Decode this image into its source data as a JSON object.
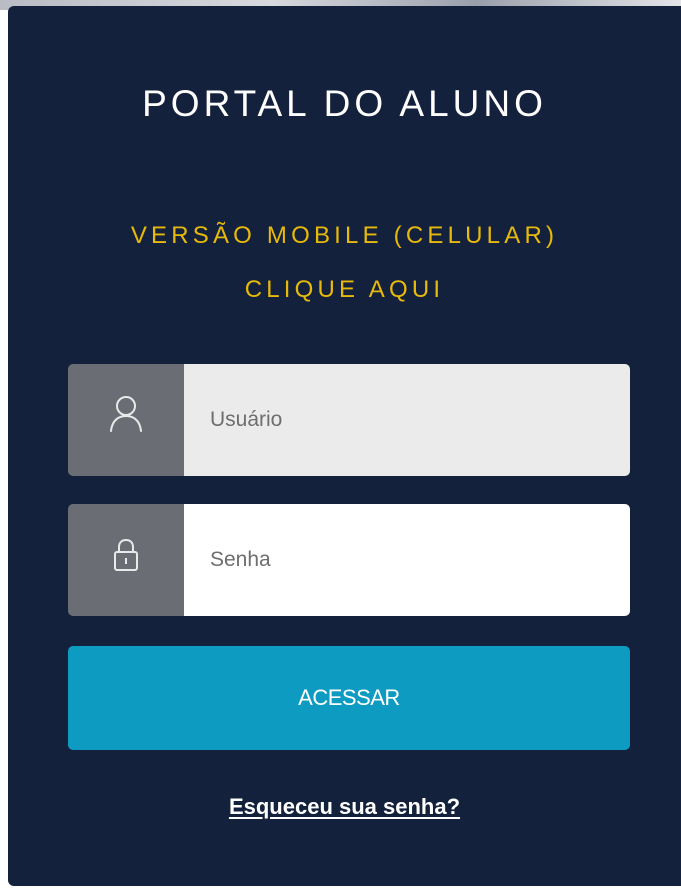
{
  "portal": {
    "title": "PORTAL DO ALUNO",
    "mobile_link_line1": "VERSÃO MOBILE (CELULAR)",
    "mobile_link_line2": "CLIQUE AQUI"
  },
  "login": {
    "username_placeholder": "Usuário",
    "password_placeholder": "Senha",
    "submit_label": "ACESSAR",
    "forgot_label": "Esqueceu sua senha?",
    "user_icon": "user-icon",
    "lock_icon": "lock-icon"
  },
  "colors": {
    "panel_bg": "#13213d",
    "accent_yellow": "#e7b90a",
    "button_blue": "#0e9bc2",
    "icon_box_gray": "#6a6d73"
  }
}
